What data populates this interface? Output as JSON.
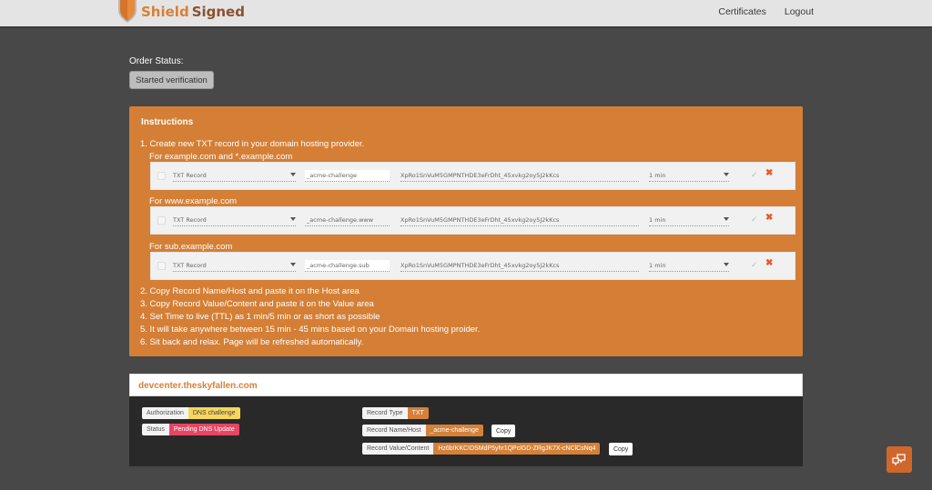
{
  "header": {
    "brand_part1": "Shield",
    "brand_part2": "Signed",
    "nav": [
      {
        "label": "Certificates"
      },
      {
        "label": "Logout"
      }
    ]
  },
  "order": {
    "label": "Order Status:",
    "status": "Started verification"
  },
  "instructions": {
    "title": "Instructions",
    "step1": "1. Create new TXT record in your domain hosting provider.",
    "groups": [
      {
        "label": "For example.com and *.example.com",
        "record": {
          "type": "TXT Record",
          "host": "_acme-challenge",
          "value": "XpRo1SnVuM5GMPNTHDE3eFrDht_45xvkg2oy5J2kKcs",
          "ttl": "1 min"
        }
      },
      {
        "label": "For www.example.com",
        "record": {
          "type": "TXT Record",
          "host": "_acme-challenge.www",
          "value": "XpRo1SnVuM5GMPNTHDE3eFrDht_45xvkg2oy5J2kKcs",
          "ttl": "1 min"
        }
      },
      {
        "label": "For sub.example.com",
        "record": {
          "type": "TXT Record",
          "host": "_acme-challenge.sub",
          "value": "XpRo1SnVuM5GMPNTHDE3eFrDht_45xvkg2oy5J2kKcs",
          "ttl": "1 min"
        }
      }
    ],
    "steps": [
      "2. Copy Record Name/Host and paste it on the Host area",
      "3. Copy Record Value/Content and paste it on the Value area",
      "4. Set Time to live (TTL) as 1 min/5 min or as short as possible",
      "5. It will take anywhere between 15 min - 45 mins based on your Domain hosting proider.",
      "6. Sit back and relax. Page will be refreshed automatically."
    ],
    "confirm_glyph": "✓",
    "delete_glyph": "✖"
  },
  "domain": {
    "name": "devcenter.theskyfallen.com",
    "authorization_label": "Authorization",
    "authorization_value": "DNS challenge",
    "status_label": "Status",
    "status_value": "Pending DNS Update",
    "record_type_label": "Record Type",
    "record_type_value": "TXT",
    "record_name_label": "Record Name/Host",
    "record_name_value": "_acme-challenge",
    "record_value_label": "Record Value/Content",
    "record_value_value": "Hz6b!KKC!DSMdP5yhr1QPclGD-ZRgJK7X-cNClCsNq4",
    "copy_label": "Copy"
  },
  "colors": {
    "accent": "#d47f35",
    "status_pending": "#e84564",
    "auth_badge": "#f6d75c"
  }
}
